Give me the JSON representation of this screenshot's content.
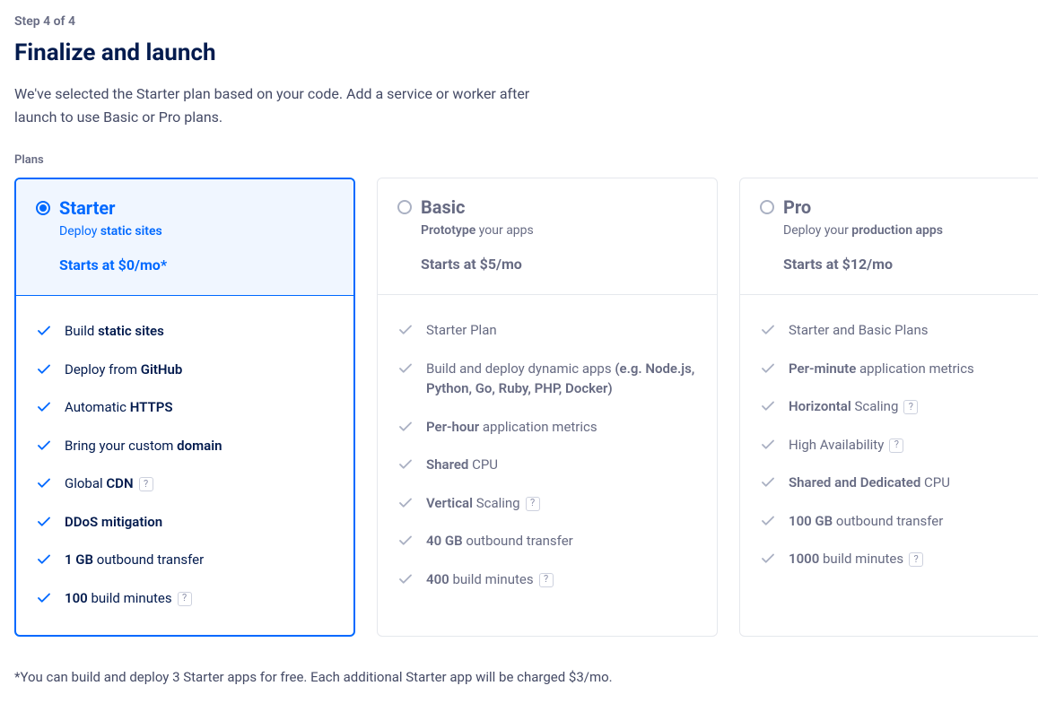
{
  "step_label": "Step 4 of 4",
  "title": "Finalize and launch",
  "subtitle": "We've selected the Starter plan based on your code. Add a service or worker after launch to use Basic or Pro plans.",
  "section_label": "Plans",
  "footnote": "*You can build and deploy 3 Starter apps for free. Each additional Starter app will be charged $3/mo.",
  "plans": [
    {
      "id": "starter",
      "name": "Starter",
      "selected": true,
      "tagline_html": "Deploy <strong>static sites</strong>",
      "price": "Starts at $0/mo*",
      "features": [
        {
          "html": "Build <strong>static sites</strong>",
          "help": false
        },
        {
          "html": "Deploy from <strong>GitHub</strong>",
          "help": false
        },
        {
          "html": "Automatic <strong>HTTPS</strong>",
          "help": false
        },
        {
          "html": "Bring your custom <strong>domain</strong>",
          "help": false
        },
        {
          "html": "Global <strong>CDN</strong>",
          "help": true
        },
        {
          "html": "<strong>DDoS mitigation</strong>",
          "help": false
        },
        {
          "html": "<strong>1 GB</strong> outbound transfer",
          "help": false
        },
        {
          "html": "<strong>100</strong> build minutes",
          "help": true
        }
      ]
    },
    {
      "id": "basic",
      "name": "Basic",
      "selected": false,
      "tagline_html": "<strong>Prototype</strong> your apps",
      "price": "Starts at $5/mo",
      "features": [
        {
          "html": "Starter Plan",
          "help": false
        },
        {
          "html": "Build and deploy dynamic apps <strong>(e.g. Node.js, Python, Go, Ruby, PHP, Docker)</strong>",
          "help": false
        },
        {
          "html": "<strong>Per-hour</strong> application metrics",
          "help": false
        },
        {
          "html": "<strong>Shared</strong> CPU",
          "help": false
        },
        {
          "html": "<strong>Vertical</strong> Scaling",
          "help": true
        },
        {
          "html": "<strong>40 GB</strong> outbound transfer",
          "help": false
        },
        {
          "html": "<strong>400</strong> build minutes",
          "help": true
        }
      ]
    },
    {
      "id": "pro",
      "name": "Pro",
      "selected": false,
      "tagline_html": "Deploy your <strong>production apps</strong>",
      "price": "Starts at $12/mo",
      "features": [
        {
          "html": "Starter and Basic Plans",
          "help": false
        },
        {
          "html": "<strong>Per-minute</strong> application metrics",
          "help": false
        },
        {
          "html": "<strong>Horizontal</strong> Scaling",
          "help": true
        },
        {
          "html": "High Availability",
          "help": true
        },
        {
          "html": "<strong>Shared and Dedicated</strong> CPU",
          "help": false
        },
        {
          "html": "<strong>100 GB</strong> outbound transfer",
          "help": false
        },
        {
          "html": "<strong>1000</strong> build minutes",
          "help": true
        }
      ]
    }
  ]
}
